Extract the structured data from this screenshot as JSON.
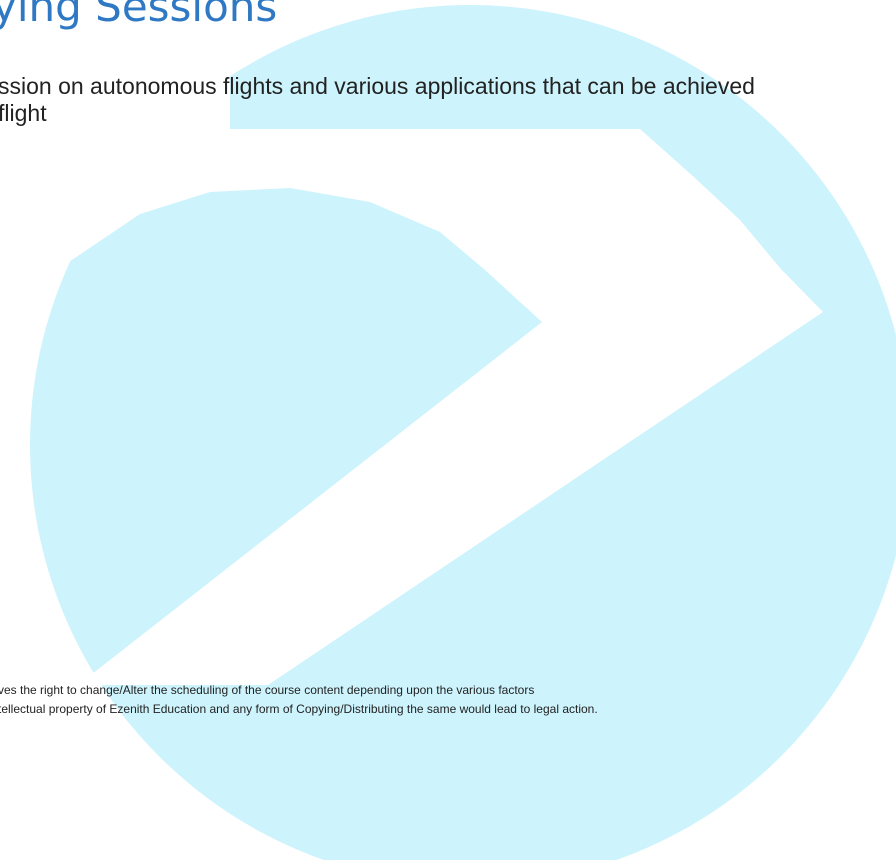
{
  "header": {
    "title": "ying Sessions"
  },
  "body": {
    "lines": [
      "ssion on autonomous flights and various applications that can be achieved",
      "flight"
    ]
  },
  "footer": {
    "lines": [
      "ves the right to change/Alter the scheduling of the course content depending upon the various factors",
      "tellectual property of Ezenith Education and any form of Copying/Distributing the same would lead to legal action."
    ]
  },
  "colors": {
    "watermark": "#cdf3fc",
    "title": "#2f78c4",
    "text": "#222222",
    "background": "#ffffff"
  }
}
